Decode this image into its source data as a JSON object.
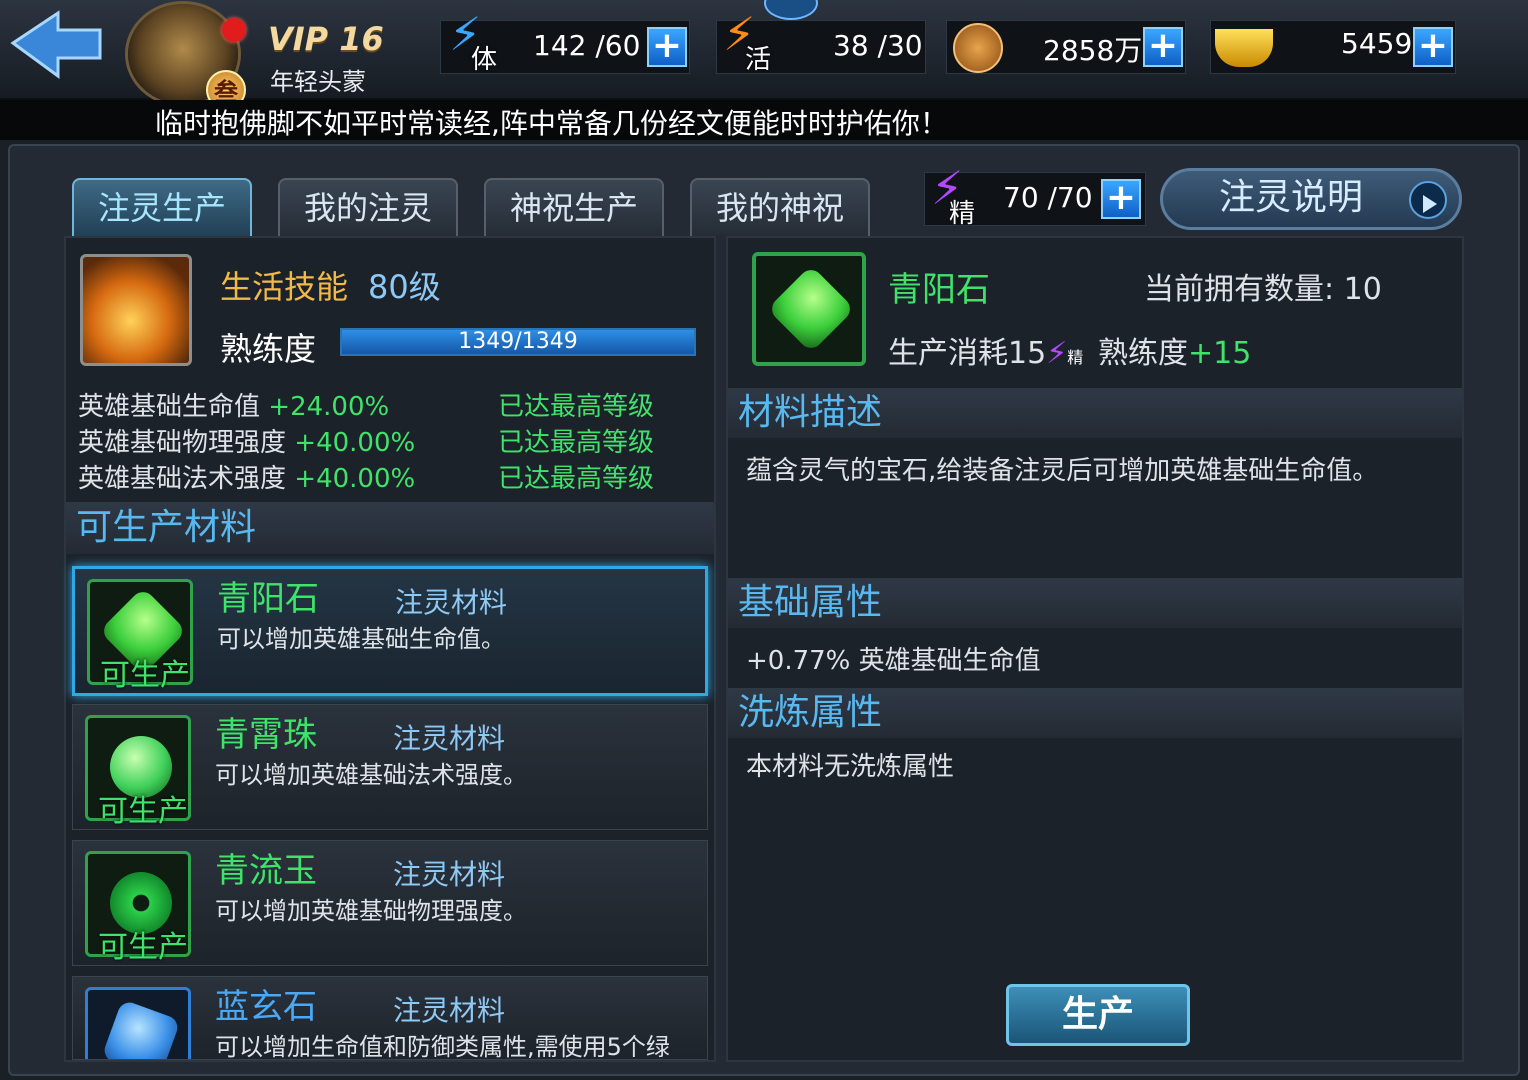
{
  "header": {
    "vip": "VIP 16",
    "player_title": "年轻头蒙",
    "rank_badge": "叁",
    "stamina": {
      "tag": "体",
      "value": "142 /60",
      "color": "#3aa7ff"
    },
    "activity": {
      "tag": "活",
      "value": "38 /30",
      "color": "#ff8a1a"
    },
    "gold": {
      "value": "2858万"
    },
    "ingot": {
      "value": "5459"
    },
    "marquee": "临时抱佛脚不如平时常读经,阵中常备几份经文便能时时护佑你！"
  },
  "tabs": [
    {
      "label": "注灵生产",
      "active": true
    },
    {
      "label": "我的注灵",
      "active": false
    },
    {
      "label": "神祝生产",
      "active": false
    },
    {
      "label": "我的神祝",
      "active": false
    }
  ],
  "essence": {
    "tag": "精",
    "value": "70 /70"
  },
  "explain_button": "注灵说明",
  "skill": {
    "title": "生活技能",
    "level": "80级",
    "proficiency_label": "熟练度",
    "proficiency_text": "1349/1349",
    "proficiency_fraction": 1.0,
    "stats": [
      {
        "name": "英雄基础生命值",
        "bonus": "+24.00%",
        "state": "已达最高等级"
      },
      {
        "name": "英雄基础物理强度",
        "bonus": "+40.00%",
        "state": "已达最高等级"
      },
      {
        "name": "英雄基础法术强度",
        "bonus": "+40.00%",
        "state": "已达最高等级"
      }
    ]
  },
  "producible_title": "可生产材料",
  "materials": [
    {
      "name": "青阳石",
      "category": "注灵材料",
      "desc": "可以增加英雄基础生命值。",
      "status": "可生产",
      "gem_color": "#4ee04e",
      "selected": true
    },
    {
      "name": "青霄珠",
      "category": "注灵材料",
      "desc": "可以增加英雄基础法术强度。",
      "status": "可生产",
      "gem_color": "#3fd05a",
      "selected": false
    },
    {
      "name": "青流玉",
      "category": "注灵材料",
      "desc": "可以增加英雄基础物理强度。",
      "status": "可生产",
      "gem_color": "#2ccf4a",
      "selected": false
    },
    {
      "name": "蓝玄石",
      "category": "注灵材料",
      "desc": "可以增加生命值和防御类属性,需使用5个绿",
      "status": "",
      "gem_color": "#3a8fe8",
      "selected": false
    }
  ],
  "detail": {
    "name": "青阳石",
    "owned": "当前拥有数量: 10",
    "cost": "生产消耗15",
    "cost_tag": "精",
    "prof_label": "熟练度",
    "prof_value": "+15",
    "desc_title": "材料描述",
    "desc": "蕴含灵气的宝石,给装备注灵后可增加英雄基础生命值。",
    "base_title": "基础属性",
    "base": "+0.77% 英雄基础生命值",
    "refine_title": "洗炼属性",
    "refine": "本材料无洗炼属性"
  },
  "produce_button": "生产"
}
